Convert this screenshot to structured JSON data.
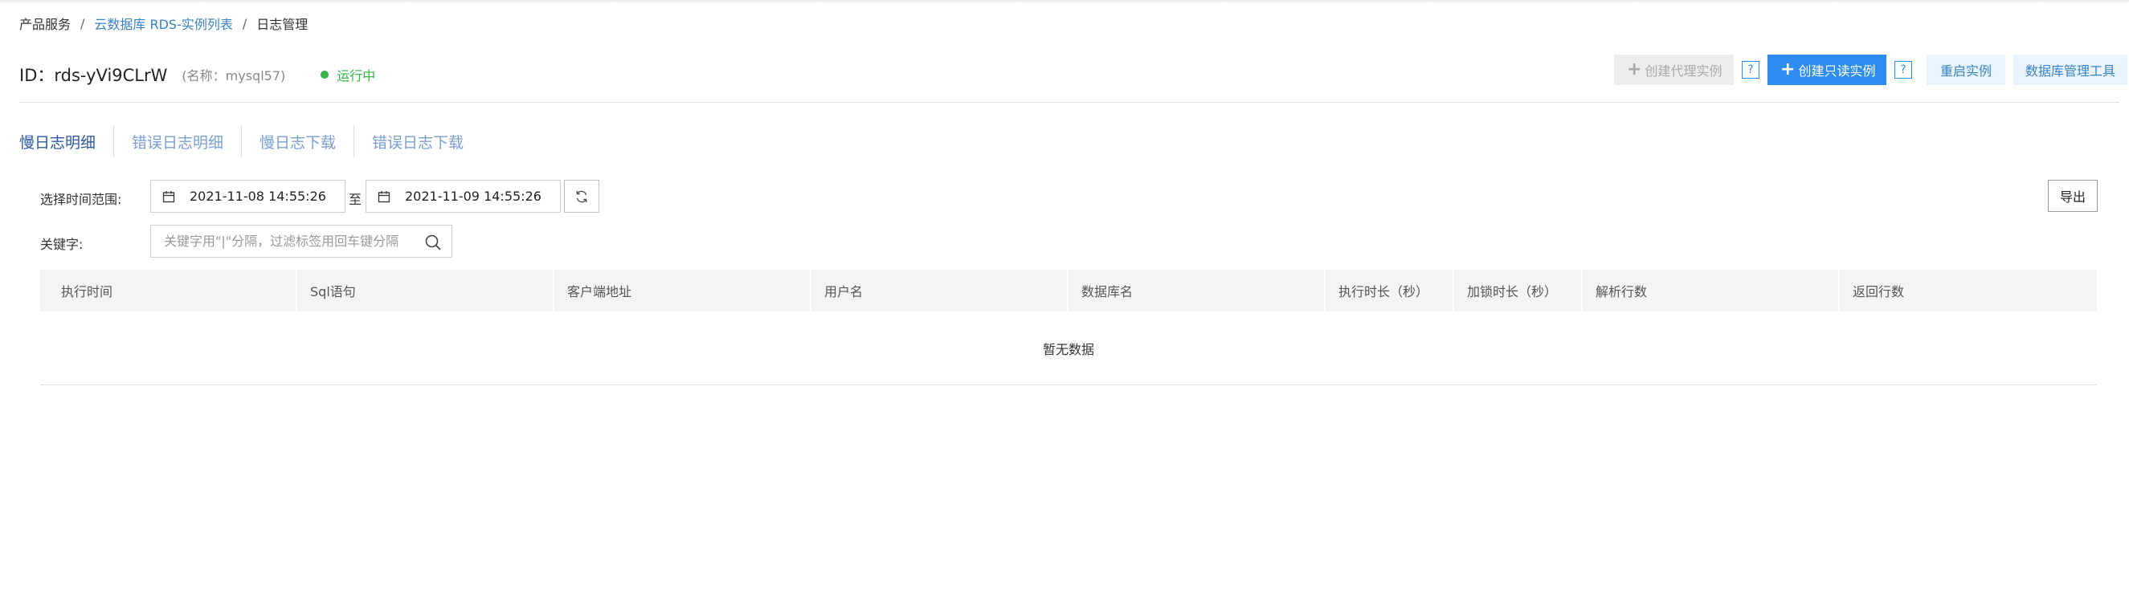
{
  "breadcrumb": {
    "items": [
      {
        "label": "产品服务",
        "link": false
      },
      {
        "label": "云数据库 RDS-实例列表",
        "link": true
      },
      {
        "label": "日志管理",
        "link": false
      }
    ],
    "separator": "/"
  },
  "instance": {
    "id_text": "ID：rds-yVi9CLrW",
    "name_text": "(名称：mysql57)",
    "status": "运行中",
    "status_color": "#36b34a"
  },
  "actions": {
    "create_proxy": "创建代理实例",
    "create_readonly": "创建只读实例",
    "help": "?",
    "restart": "重启实例",
    "db_tool": "数据库管理工具"
  },
  "tabs": [
    {
      "label": "慢日志明细",
      "active": true
    },
    {
      "label": "错误日志明细",
      "active": false
    },
    {
      "label": "慢日志下载",
      "active": false
    },
    {
      "label": "错误日志下载",
      "active": false
    }
  ],
  "filters": {
    "time_range_label": "选择时间范围:",
    "start_time": "2021-11-08 14:55:26",
    "to": "至",
    "end_time": "2021-11-09 14:55:26",
    "keyword_label": "关键字:",
    "keyword_placeholder": "关键字用\"|\"分隔，过滤标签用回车键分隔",
    "keyword_value": "",
    "export": "导出"
  },
  "table": {
    "columns": [
      "执行时间",
      "Sql语句",
      "客户端地址",
      "用户名",
      "数据库名",
      "执行时长（秒）",
      "加锁时长（秒）",
      "解析行数",
      "返回行数"
    ],
    "rows": [],
    "empty_text": "暂无数据"
  },
  "colors": {
    "primary": "#2f8cf0",
    "link": "#3b82c4",
    "tab_active": "#2c5a9e",
    "tab_inactive": "#7a9fd3"
  }
}
